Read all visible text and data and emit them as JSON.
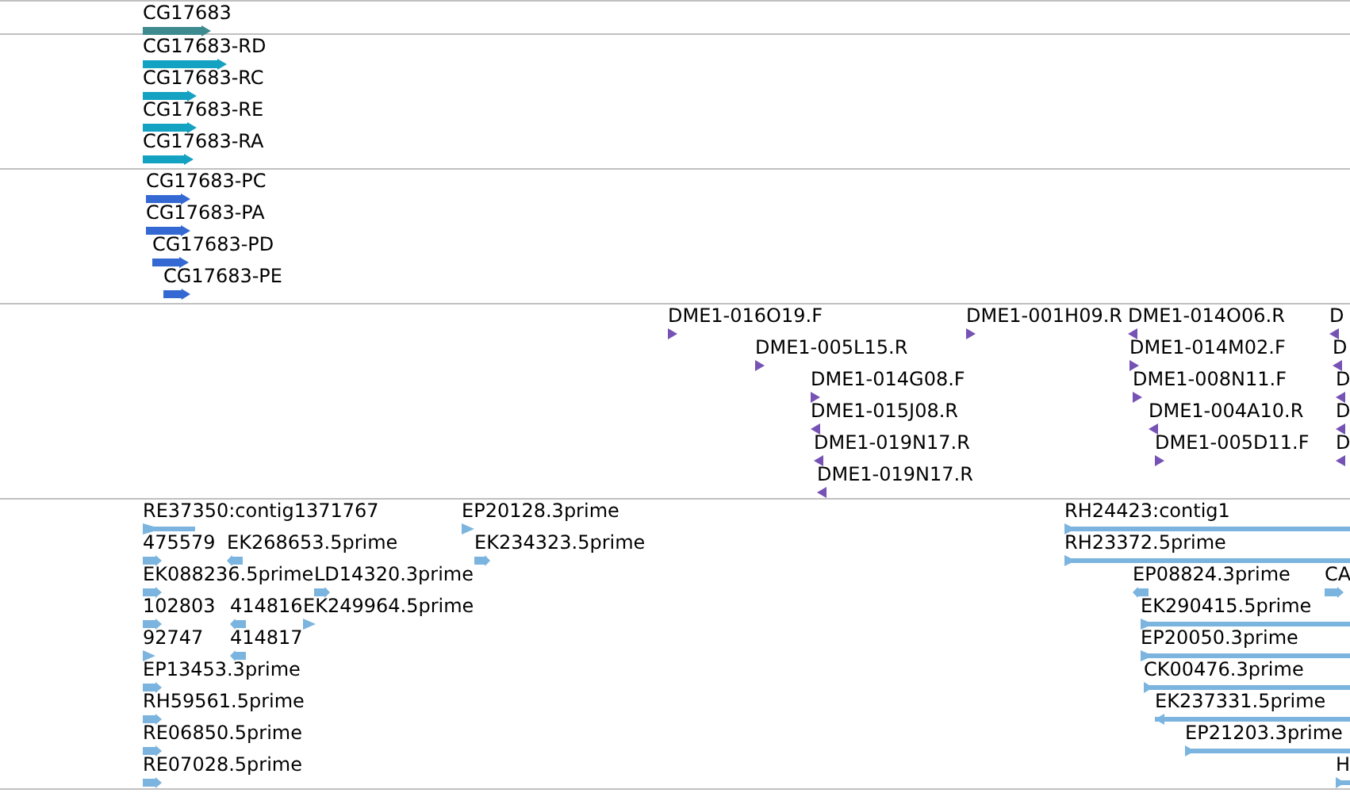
{
  "tracks": [
    {
      "features": [
        {
          "label": "CG17683",
          "reverse": false
        }
      ]
    },
    {
      "features": [
        {
          "label": "CG17683-RD",
          "reverse": false
        },
        {
          "label": "CG17683-RC",
          "reverse": false
        },
        {
          "label": "CG17683-RE",
          "reverse": false
        },
        {
          "label": "CG17683-RA",
          "reverse": false
        }
      ]
    },
    {
      "features": [
        {
          "label": "CG17683-PC",
          "reverse": false
        },
        {
          "label": "CG17683-PA",
          "reverse": false
        },
        {
          "label": "CG17683-PD",
          "reverse": false
        },
        {
          "label": "CG17683-PE",
          "reverse": false
        }
      ]
    },
    {
      "features": [
        {
          "label": "DME1-016O19.F",
          "reverse": false
        },
        {
          "label": "DME1-005L15.R",
          "reverse": false
        },
        {
          "label": "DME1-014G08.F",
          "reverse": false
        },
        {
          "label": "DME1-015J08.R",
          "reverse": true
        },
        {
          "label": "DME1-019N17.R",
          "reverse": true
        },
        {
          "label": "DME1-019N17.R",
          "reverse": true
        },
        {
          "label": "DME1-001H09.R",
          "reverse": false
        },
        {
          "label": "DME1-014O06.R",
          "reverse": true
        },
        {
          "label": "DME1-014M02.F",
          "reverse": false
        },
        {
          "label": "DME1-008N11.F",
          "reverse": false
        },
        {
          "label": "DME1-004A10.R",
          "reverse": true
        },
        {
          "label": "DME1-005D11.F",
          "reverse": false
        },
        {
          "label": "D",
          "reverse": true
        },
        {
          "label": "D",
          "reverse": true
        },
        {
          "label": "D",
          "reverse": true
        },
        {
          "label": "D",
          "reverse": true
        },
        {
          "label": "D",
          "reverse": true
        }
      ]
    },
    {
      "features": [
        {
          "label": "RE37350:contig1371767",
          "reverse": false
        },
        {
          "label": "EP20128.3prime",
          "reverse": false
        },
        {
          "label": "475579",
          "reverse": false
        },
        {
          "label": "EK268653.5prime",
          "reverse": true
        },
        {
          "label": "EK234323.5prime",
          "reverse": false
        },
        {
          "label": "EK088236.5prime",
          "reverse": false
        },
        {
          "label": "LD14320.3prime",
          "reverse": false
        },
        {
          "label": "102803",
          "reverse": false
        },
        {
          "label": "414816",
          "reverse": true
        },
        {
          "label": "EK249964.5prime",
          "reverse": false
        },
        {
          "label": "92747",
          "reverse": false
        },
        {
          "label": "414817",
          "reverse": true
        },
        {
          "label": "EP13453.3prime",
          "reverse": false
        },
        {
          "label": "RH59561.5prime",
          "reverse": false
        },
        {
          "label": "RE06850.5prime",
          "reverse": false
        },
        {
          "label": "RE07028.5prime",
          "reverse": false
        },
        {
          "label": "RH24423:contig1",
          "reverse": false
        },
        {
          "label": "RH23372.5prime",
          "reverse": false
        },
        {
          "label": "EP08824.3prime",
          "reverse": true
        },
        {
          "label": "CA",
          "reverse": false
        },
        {
          "label": "EK290415.5prime",
          "reverse": false
        },
        {
          "label": "EP20050.3prime",
          "reverse": false
        },
        {
          "label": "CK00476.3prime",
          "reverse": false
        },
        {
          "label": "EK237331.5prime",
          "reverse": true
        },
        {
          "label": "EP21203.3prime",
          "reverse": false
        },
        {
          "label": "H",
          "reverse": false
        }
      ]
    }
  ]
}
